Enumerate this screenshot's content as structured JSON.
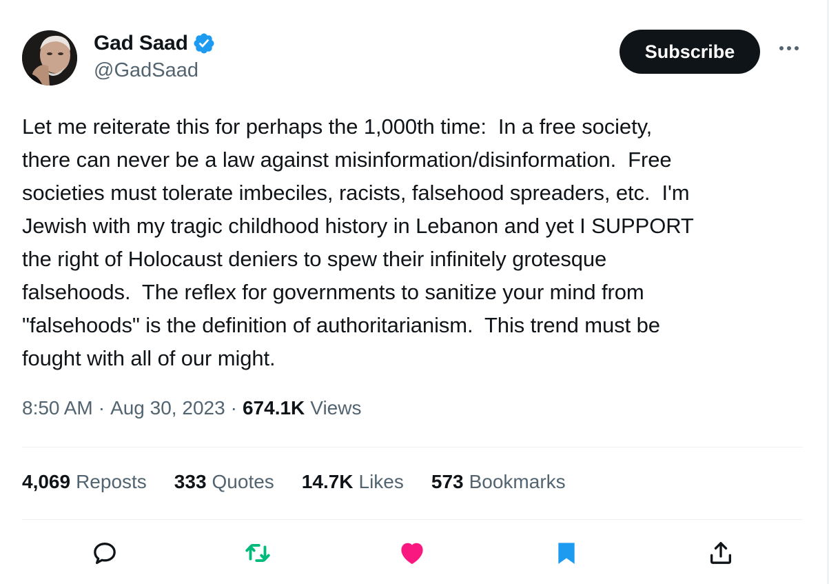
{
  "author": {
    "display_name": "Gad Saad",
    "handle": "@GadSaad",
    "verified": true
  },
  "header": {
    "subscribe_label": "Subscribe",
    "more_icon": "more-horizontal-icon"
  },
  "tweet": {
    "text": "Let me reiterate this for perhaps the 1,000th time:  In a free society,\nthere can never be a law against misinformation/disinformation.  Free\nsocieties must tolerate imbeciles, racists, falsehood spreaders, etc.  I'm\nJewish with my tragic childhood history in Lebanon and yet I SUPPORT\nthe right of Holocaust deniers to spew their infinitely grotesque\nfalsehoods.  The reflex for governments to sanitize your mind from\n\"falsehoods\" is the definition of authoritarianism.  This trend must be\nfought with all of our might.",
    "time": "8:50 AM",
    "date": "Aug 30, 2023",
    "separator": "·",
    "views_count": "674.1K",
    "views_label": "Views"
  },
  "stats": [
    {
      "count": "4,069",
      "label": "Reposts"
    },
    {
      "count": "333",
      "label": "Quotes"
    },
    {
      "count": "14.7K",
      "label": "Likes"
    },
    {
      "count": "573",
      "label": "Bookmarks"
    }
  ],
  "actions": [
    {
      "icon": "reply-icon"
    },
    {
      "icon": "repost-icon",
      "color": "#00ba7c"
    },
    {
      "icon": "like-icon",
      "color": "#f91880"
    },
    {
      "icon": "bookmark-icon",
      "color": "#1d9bf0"
    },
    {
      "icon": "share-icon"
    }
  ],
  "colors": {
    "text_primary": "#0f1419",
    "text_secondary": "#536471",
    "verified_blue": "#1d9bf0",
    "divider": "#eff3f4"
  }
}
